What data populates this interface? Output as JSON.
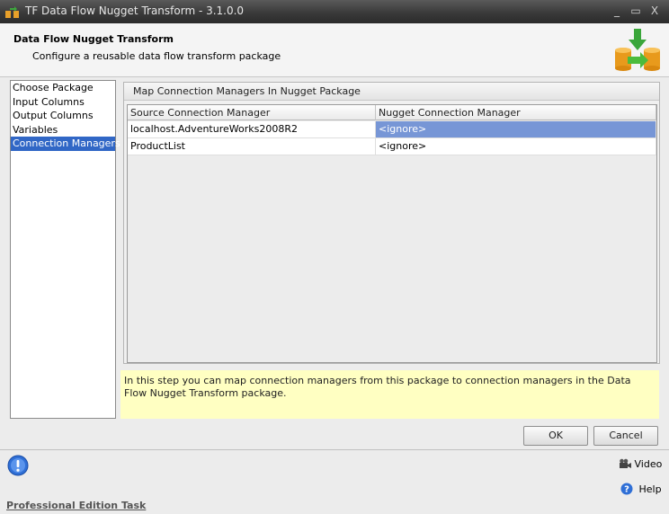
{
  "window": {
    "title": "TF Data Flow Nugget Transform - 3.1.0.0",
    "minimize_glyph": "_",
    "maximize_glyph": "▭",
    "close_glyph": "X"
  },
  "header": {
    "title": "Data Flow Nugget Transform",
    "subtitle": "Configure a reusable data flow transform package"
  },
  "nav": {
    "items": [
      {
        "label": "Choose Package",
        "selected": false
      },
      {
        "label": "Input Columns",
        "selected": false
      },
      {
        "label": "Output Columns",
        "selected": false
      },
      {
        "label": "Variables",
        "selected": false
      },
      {
        "label": "Connection Managers",
        "selected": true
      }
    ]
  },
  "panel": {
    "title": "Map Connection Managers In Nugget Package",
    "columns": [
      "Source Connection Manager",
      "Nugget Connection Manager"
    ],
    "rows": [
      {
        "source": "localhost.AdventureWorks2008R2",
        "nugget": "<ignore>",
        "highlighted": true
      },
      {
        "source": "ProductList",
        "nugget": "<ignore>",
        "highlighted": false
      }
    ]
  },
  "info_text": "In this step you can map connection managers from this package to connection managers in the Data Flow Nugget Transform package.",
  "buttons": {
    "ok": "OK",
    "cancel": "Cancel"
  },
  "footer": {
    "video": "Video",
    "help": "Help",
    "edition": "Professional Edition Task"
  },
  "colors": {
    "selection": "#3167c6",
    "highlight_cell": "#7796d6",
    "info_background": "#ffffc2"
  }
}
